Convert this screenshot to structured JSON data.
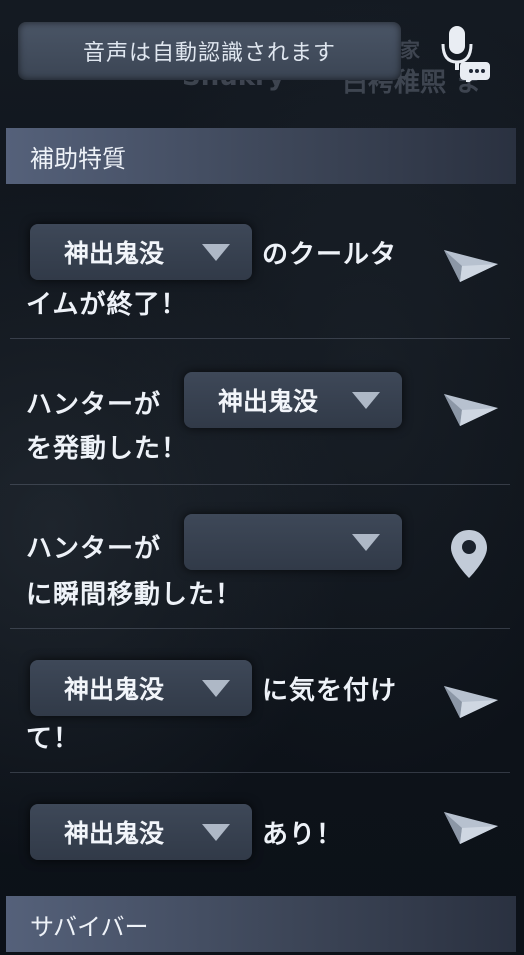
{
  "background": {
    "name_left": "Shukry",
    "name_right": "白袴稚煕 ま",
    "name_small": "ゆ家"
  },
  "voice": {
    "text": "音声は自動認識されます"
  },
  "sections": {
    "support_trait": "補助特質",
    "survivor": "サバイバー"
  },
  "messages": [
    {
      "dropdown": "神出鬼没",
      "line1": "のクールタ",
      "line2": "イムが終了！"
    },
    {
      "prefix": "ハンターが",
      "dropdown": "神出鬼没",
      "line2": "を発動した！"
    },
    {
      "prefix": "ハンターが",
      "dropdown": "",
      "line2": "に瞬間移動した！"
    },
    {
      "dropdown": "神出鬼没",
      "line1": "に気を付け",
      "line2": "て！"
    },
    {
      "dropdown": "神出鬼没",
      "line1": "あり！"
    }
  ],
  "icons": {
    "mic": "microphone-chat-icon",
    "send": "paper-plane-icon",
    "pin": "location-pin-icon",
    "caret": "caret-down-icon"
  }
}
